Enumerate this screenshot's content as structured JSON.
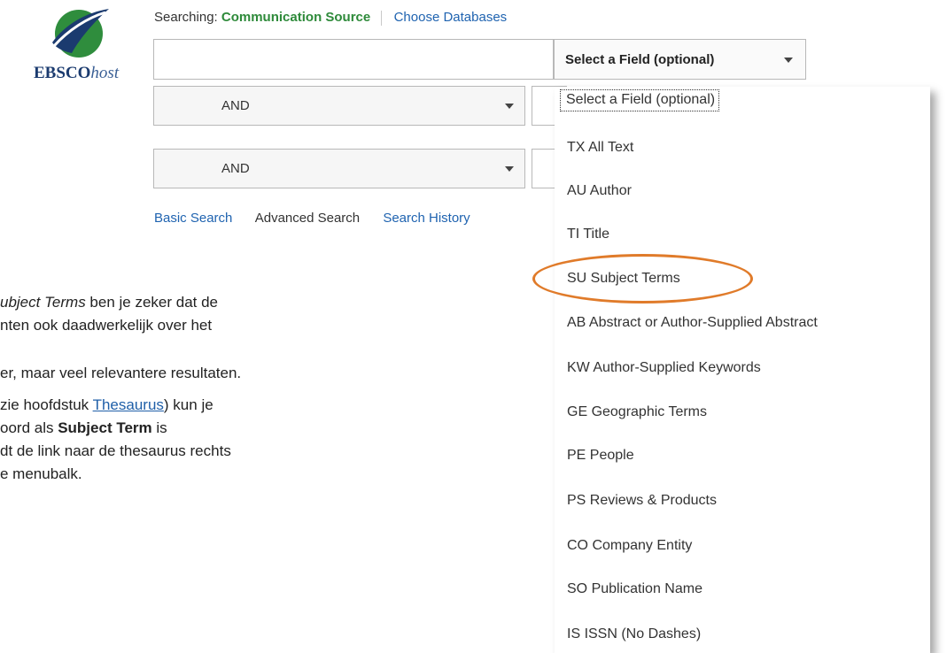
{
  "logo": {
    "brand_bold": "EBSCO",
    "brand_italic": "host"
  },
  "search": {
    "searching_label": "Searching:",
    "database": "Communication Source",
    "choose_databases": "Choose Databases",
    "main_input_value": "",
    "field_select_value": "Select a Field (optional)"
  },
  "rows": [
    {
      "operator": "AND"
    },
    {
      "operator": "AND"
    }
  ],
  "links": {
    "basic": "Basic Search",
    "advanced": "Advanced Search",
    "history": "Search History"
  },
  "dropdown": {
    "options": [
      "Select a Field (optional)",
      "TX All Text",
      "AU Author",
      "TI Title",
      "SU Subject Terms",
      "AB Abstract or Author-Supplied Abstract",
      "KW Author-Supplied Keywords",
      "GE Geographic Terms",
      "PE People",
      "PS Reviews & Products",
      "CO Company Entity",
      "SO Publication Name",
      "IS ISSN (No Dashes)"
    ],
    "highlighted": "SU Subject Terms"
  },
  "text": {
    "l1_italic": "ubject Terms",
    "l1_rest": " ben je zeker dat de",
    "l2": "nten ook daadwerkelijk over het",
    "l3": "er, maar veel relevantere resultaten.",
    "l4_a": "zie hoofdstuk ",
    "l4_link": "Thesaurus",
    "l4_b": ") kun je",
    "l5_a": "oord als ",
    "l5_bold": "Subject Term",
    "l5_b": " is",
    "l6": "dt de link naar de thesaurus rechts",
    "l7": "e menubalk."
  },
  "colors": {
    "accent_green": "#2e8a3a",
    "link_blue": "#1f63b0",
    "highlight_orange": "#e07b2a",
    "logo_navy": "#1b3b6f"
  }
}
